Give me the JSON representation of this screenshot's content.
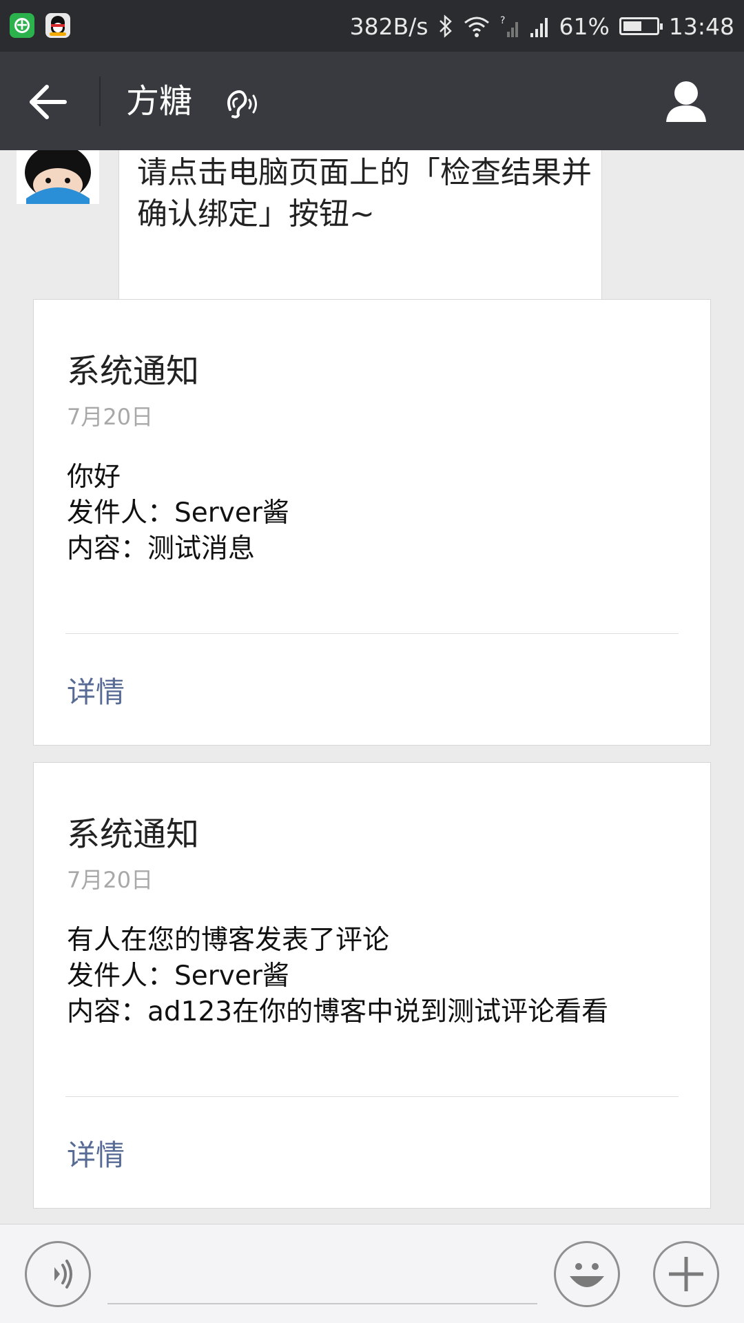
{
  "status_bar": {
    "network_speed": "382B/s",
    "battery_percent": "61%",
    "battery_level": 0.61,
    "time": "13:48",
    "icons": [
      "wechat-notification-icon",
      "qq-icon",
      "bluetooth-icon",
      "wifi-icon",
      "signal-icon",
      "battery-icon"
    ]
  },
  "header": {
    "title": "方糖",
    "icons": [
      "back-arrow-icon",
      "earpiece-icon",
      "profile-icon"
    ]
  },
  "chat": {
    "partial_message": "扫码成功，还差一步就完成啦！\n请点击电脑页面上的「检查结果并确认绑定」按钮~",
    "notifications": [
      {
        "title": "系统通知",
        "date": "7月20日",
        "lines": [
          "你好",
          "发件人：Server酱",
          "内容：测试消息"
        ],
        "link": "详情"
      },
      {
        "title": "系统通知",
        "date": "7月20日",
        "lines": [
          "有人在您的博客发表了评论",
          "发件人：Server酱",
          "内容：ad123在你的博客中说到测试评论看看"
        ],
        "link": "详情"
      }
    ]
  },
  "input_bar": {
    "message_value": "",
    "icons": [
      "voice-icon",
      "emoji-icon",
      "plus-icon"
    ]
  },
  "colors": {
    "status_bar_bg": "#2b2c2f",
    "title_bar_bg": "#393a3f",
    "chat_bg": "#ebebeb",
    "link": "#576b95",
    "wechat_green": "#2bb24c"
  }
}
